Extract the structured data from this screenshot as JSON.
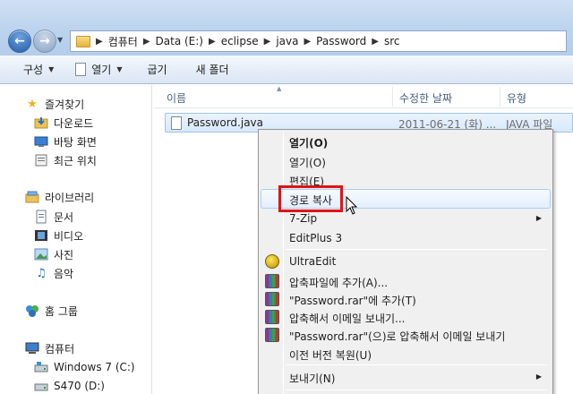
{
  "address": {
    "segments": [
      "컴퓨터",
      "Data (E:)",
      "eclipse",
      "java",
      "Password",
      "src"
    ]
  },
  "toolbar": {
    "organize": "구성",
    "open": "열기",
    "burn": "굽기",
    "new_folder": "새 폴더"
  },
  "nav": {
    "favorites": "즐겨찾기",
    "downloads": "다운로드",
    "desktop": "바탕 화면",
    "recent": "최근 위치",
    "libraries": "라이브러리",
    "documents": "문서",
    "videos": "비디오",
    "pictures": "사진",
    "music": "음악",
    "homegroup": "홈 그룹",
    "computer": "컴퓨터",
    "drive_c": "Windows 7 (C:)",
    "drive_d": "S470 (D:)"
  },
  "columns": {
    "name": "이름",
    "date": "수정한 날짜",
    "type": "유형"
  },
  "file": {
    "name": "Password.java",
    "date": "2011-06-21 (화) ...",
    "type": "JAVA 파일"
  },
  "context_menu": {
    "items": [
      "열기(O)",
      "열기(O)",
      "편집(E)",
      "경로 복사",
      "7-Zip",
      "EditPlus 3",
      "UltraEdit",
      "압축파일에 추가(A)...",
      "\"Password.rar\"에 추가(T)",
      "압축해서 이메일 보내기...",
      "\"Password.rar\"(으)로 압축해서 이메일 보내기",
      "이전 버전 복원(U)",
      "보내기(N)"
    ]
  },
  "colors": {
    "highlight_box": "#e01515",
    "selection": "#d8e9fb"
  }
}
